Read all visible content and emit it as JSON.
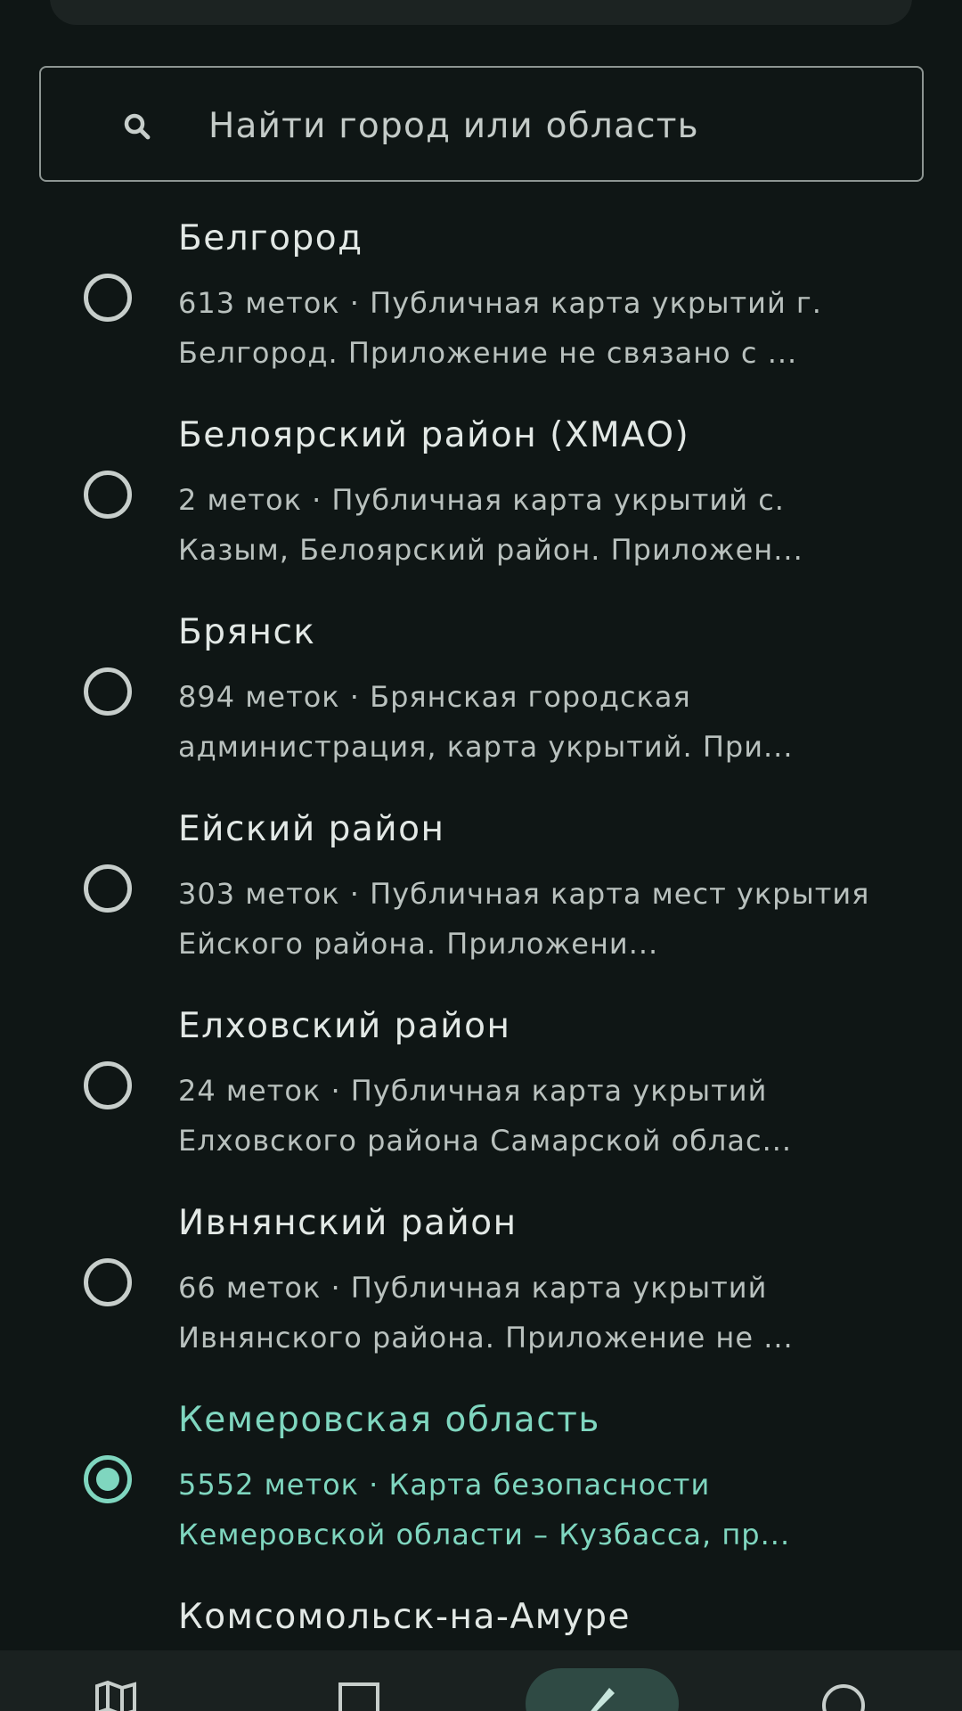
{
  "search": {
    "placeholder": "Найти город или область"
  },
  "items": [
    {
      "title": "Белгород",
      "subtitle": "613 меток · Публичная карта укрытий г. Белгород. Приложение не связано с ..."
    },
    {
      "title": "Белоярский район (ХМАО)",
      "subtitle": "2 меток · Публичная карта укрытий с. Казым, Белоярский район. Приложен..."
    },
    {
      "title": "Брянск",
      "subtitle": "894 меток · Брянская городская администрация, карта укрытий. При..."
    },
    {
      "title": "Ейский район",
      "subtitle": "303 меток · Публичная карта мест укрытия Ейского района. Приложени..."
    },
    {
      "title": "Елховский район",
      "subtitle": "24 меток · Публичная карта укрытий Елховского района Самарской облас..."
    },
    {
      "title": "Ивнянский район",
      "subtitle": "66 меток · Публичная карта укрытий Ивнянского района. Приложение не ..."
    },
    {
      "title": "Кемеровская область",
      "subtitle": "5552 меток · Карта безопасности Кемеровской области – Кузбасса, пр...",
      "selected": true
    },
    {
      "title": "Комсомольск-на-Амуре",
      "subtitle": ""
    }
  ],
  "bottom_nav": {
    "items": [
      {
        "icon": "map-icon"
      },
      {
        "icon": "list-icon"
      },
      {
        "icon": "edit-icon",
        "active": true
      },
      {
        "icon": "info-icon"
      }
    ]
  },
  "colors": {
    "background": "#0f1615",
    "accent": "#7fd6bf",
    "text": "#e2e8e5",
    "subtext": "#b9c1be"
  }
}
